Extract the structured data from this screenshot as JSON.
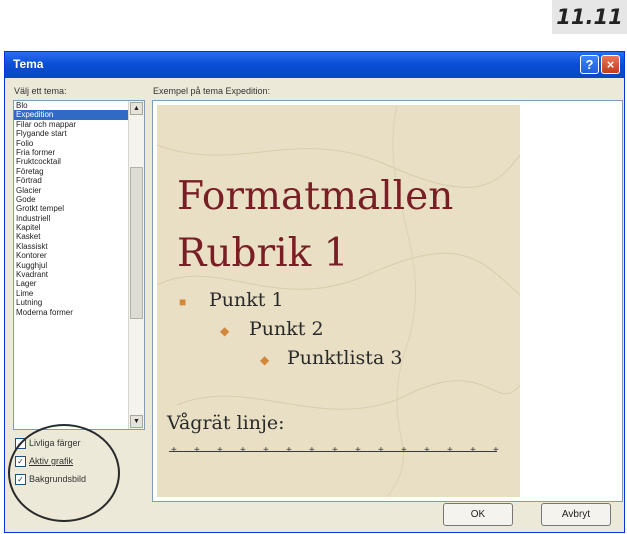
{
  "figure_number": "11.11",
  "dialog": {
    "title": "Tema",
    "help_icon": "?",
    "close_icon": "×"
  },
  "theme_list": {
    "label": "Välj ett tema:",
    "items": [
      "Blo",
      "Expedition",
      "Filar och mappar",
      "Flygande start",
      "Folio",
      "Fria former",
      "Fruktcocktail",
      "Företag",
      "Förtrad",
      "Glacier",
      "Gode",
      "Grotkt tempel",
      "Industriell",
      "Kapitel",
      "Kasket",
      "Klassiskt",
      "Kontorer",
      "Kugghjul",
      "Kvadrant",
      "Lager",
      "Lime",
      "Lutning",
      "Moderna former"
    ],
    "selected": "Expedition",
    "scroll_up": "▲",
    "scroll_down": "▼"
  },
  "options": [
    {
      "label": "Livliga färger",
      "checked": true
    },
    {
      "label": "Aktiv grafik",
      "checked": true
    },
    {
      "label": "Bakgrundsbild",
      "checked": true
    }
  ],
  "preview": {
    "label": "Exempel på tema Expedition:",
    "heading_line1": "Formatmallen",
    "heading_line2": "Rubrik 1",
    "bullet1": "Punkt 1",
    "bullet2": "Punkt 2",
    "bullet3": "Punktlista 3",
    "rule_label": "Vågrät linje:",
    "colors": {
      "background": "#e8dfc4",
      "heading": "#7a1e26",
      "bullet": "#d2883a"
    }
  },
  "buttons": {
    "ok": "OK",
    "cancel": "Avbryt"
  }
}
